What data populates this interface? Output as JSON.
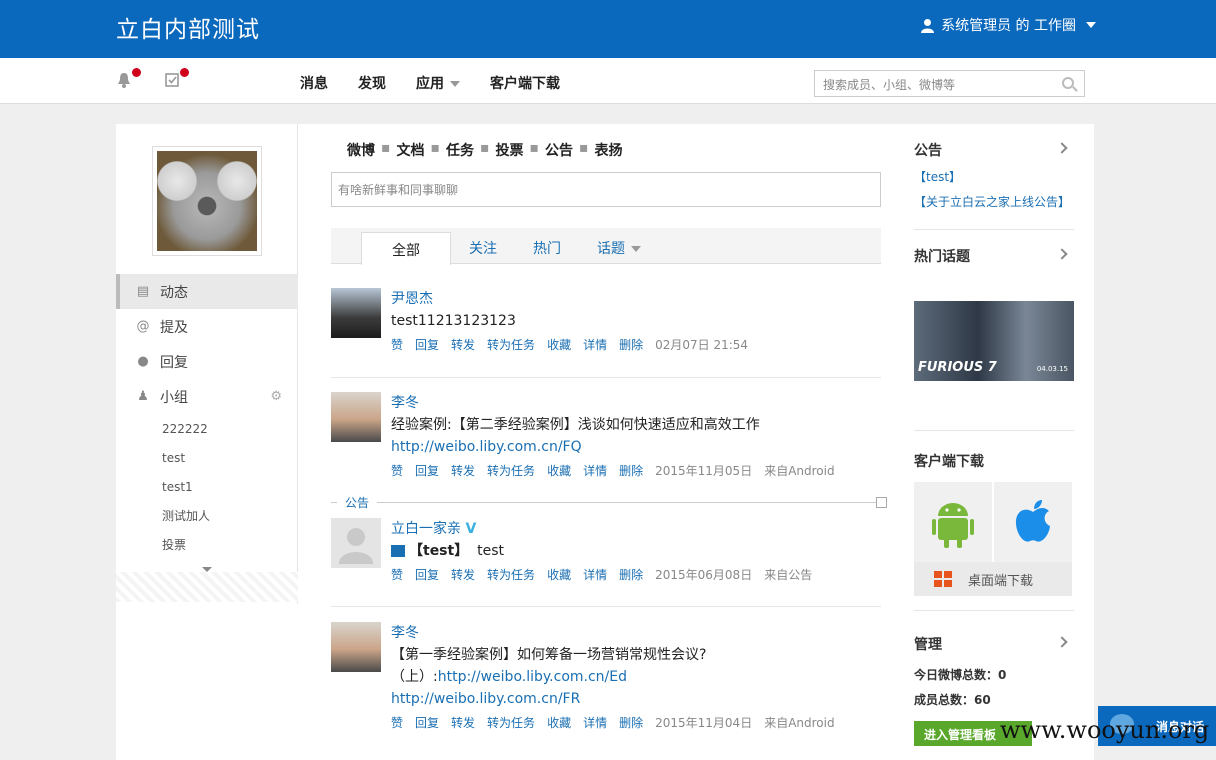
{
  "header": {
    "brand": "立白内部测试",
    "user_label": "系统管理员 的 工作圈"
  },
  "nav": {
    "items": [
      "消息",
      "发现",
      "应用",
      "客户端下载"
    ],
    "search_placeholder": "搜索成员、小组、微博等"
  },
  "sidebar": {
    "menu": [
      {
        "label": "动态",
        "icon": "chart-icon"
      },
      {
        "label": "提及",
        "icon": "at-icon"
      },
      {
        "label": "回复",
        "icon": "reply-icon"
      },
      {
        "label": "小组",
        "icon": "group-icon"
      }
    ],
    "groups": [
      "222222",
      "test",
      "test1",
      "测试加人",
      "投票"
    ]
  },
  "publish": {
    "tabs": [
      "微博",
      "文档",
      "任务",
      "投票",
      "公告",
      "表扬"
    ],
    "placeholder": "有啥新鲜事和同事聊聊"
  },
  "feed_tabs": [
    "全部",
    "关注",
    "热门",
    "话题"
  ],
  "actions": [
    "赞",
    "回复",
    "转发",
    "转为任务",
    "收藏",
    "详情",
    "删除"
  ],
  "announce_tag": "公告",
  "posts": [
    {
      "name": "尹恩杰",
      "text": "test11213123123",
      "time": "02月07日 21:54",
      "source": ""
    },
    {
      "name": "李冬",
      "text": "经验案例:【第二季经验案例】浅谈如何快速适应和高效工作",
      "link": "http://weibo.liby.com.cn/FQ",
      "time": "2015年11月05日",
      "source": "来自Android"
    },
    {
      "name": "立白一家亲",
      "text_bold": "【test】",
      "text": "test",
      "time": "2015年06月08日",
      "source": "来自公告"
    },
    {
      "name": "李冬",
      "text": "【第一季经验案例】如何筹备一场营销常规性会议?",
      "text2_prefix": "（上）:",
      "link": "http://weibo.liby.com.cn/Ed",
      "link2": "http://weibo.liby.com.cn/FR",
      "time": "2015年11月04日",
      "source": "来自Android"
    }
  ],
  "right": {
    "notice_title": "公告",
    "notices": [
      "【test】",
      "【关于立白云之家上线公告】"
    ],
    "hot_title": "热门话题",
    "movie_title": "FURIOUS 7",
    "movie_date": "04.03.15",
    "download_title": "客户端下载",
    "desktop_label": "桌面端下载",
    "admin_title": "管理",
    "stat_today_label": "今日微博总数：",
    "stat_today": "0",
    "stat_members_label": "成员总数：",
    "stat_members": "60",
    "admin_button": "进入管理看板"
  },
  "chat_label": "消息对话",
  "watermark": "www.wooyun.org",
  "colors": {
    "brand": "#0a68bd",
    "link": "#1a6fb3",
    "alert": "#d0021b",
    "admin_button": "#5aa82b"
  }
}
